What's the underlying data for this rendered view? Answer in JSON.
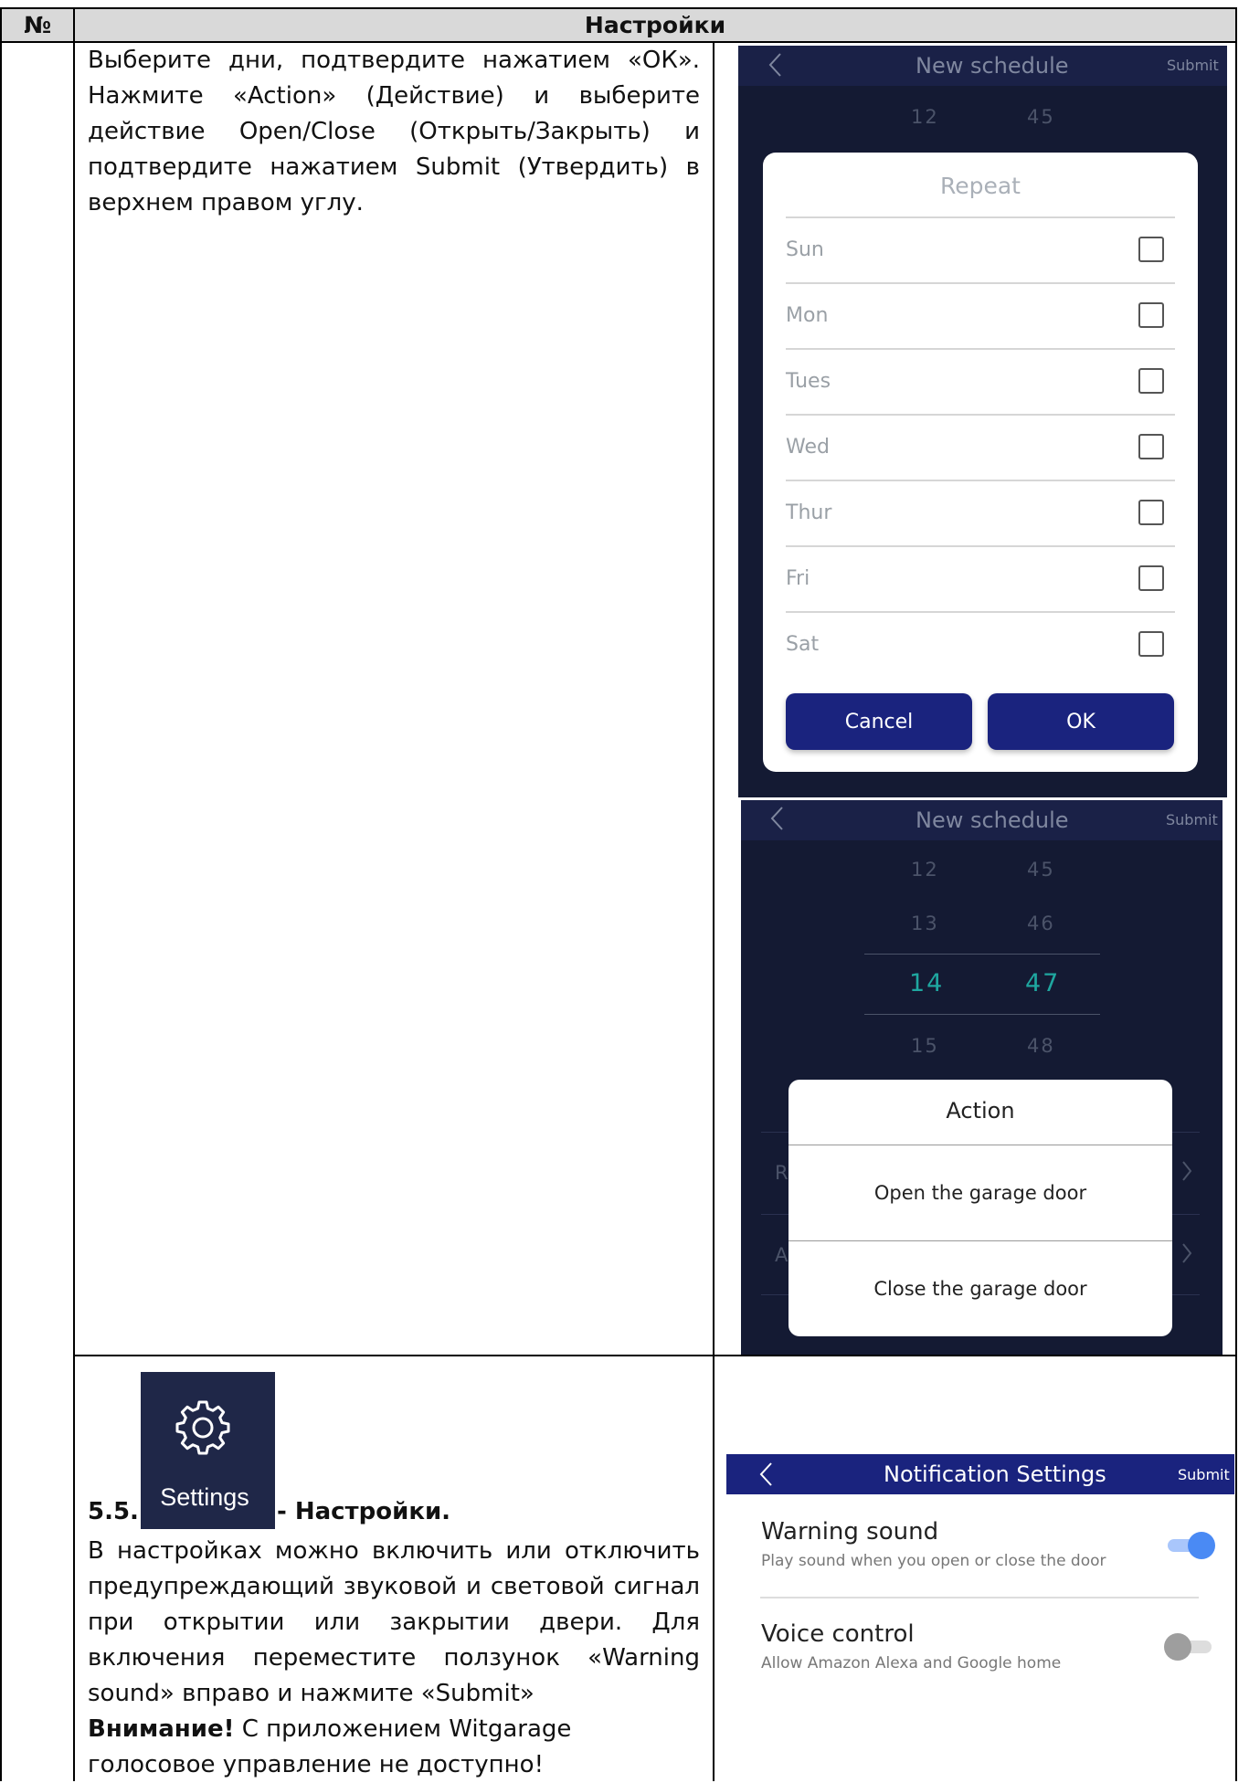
{
  "table": {
    "col_no": "№",
    "col_settings": "Настройки"
  },
  "row1": {
    "paragraph": "Выберите дни, подтвердите нажатием «ОК». Нажмите «Action» (Действие) и выберите действие Open/Close (Открыть/Закрыть) и подтвердите нажатием Submit (Утвердить) в верхнем правом углу."
  },
  "schedule_screen": {
    "title": "New schedule",
    "submit": "Submit",
    "picker_hours": [
      "12",
      "13",
      "14",
      "15"
    ],
    "picker_minutes": [
      "45",
      "46",
      "47",
      "48"
    ],
    "row_letter_1": "R",
    "row_letter_2": "A"
  },
  "repeat_dialog": {
    "title": "Repeat",
    "days": [
      "Sun",
      "Mon",
      "Tues",
      "Wed",
      "Thur",
      "Fri",
      "Sat"
    ],
    "cancel": "Cancel",
    "ok": "OK"
  },
  "action_dialog": {
    "title": "Action",
    "options": [
      "Open the garage door",
      "Close the garage door"
    ]
  },
  "row2": {
    "settings_icon_label": "Settings",
    "heading_num": "5.5.",
    "heading_text": "- Настройки.",
    "paragraph": "В настройках можно включить или отключить предупреждающий звуковой и световой сигнал при открытии или закрытии двери. Для включения переместите ползунок «Warning sound» вправо и нажмите «Submit»",
    "warning_bold": "Внимание!",
    "warning_text": "С приложением Witgarage голосовое управление не доступно!"
  },
  "notification_screen": {
    "title": "Notification Settings",
    "submit": "Submit",
    "items": [
      {
        "title": "Warning sound",
        "subtitle": "Play sound when you open or close the door",
        "enabled": true
      },
      {
        "title": "Voice control",
        "subtitle": "Allow Amazon Alexa and Google home",
        "enabled": false
      }
    ]
  },
  "colors": {
    "dark_bg": "#141a33",
    "navy": "#1a237e",
    "toggle_on": "#4a8af4",
    "accent_teal": "#1fa7a0"
  }
}
